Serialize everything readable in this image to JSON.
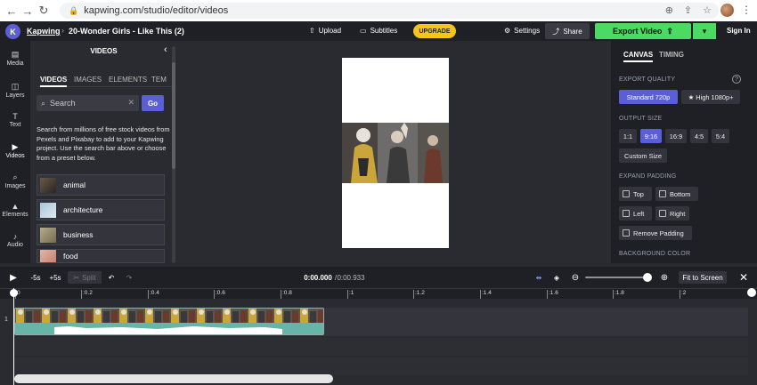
{
  "browser": {
    "url": "kapwing.com/studio/editor/videos"
  },
  "topbar": {
    "brand": "Kapwing",
    "project_title": "20-Wonder Girls - Like This (2)",
    "upload_label": "Upload",
    "subtitles_label": "Subtitles",
    "upgrade_label": "UPGRADE",
    "settings_label": "Settings",
    "share_label": "Share",
    "export_label": "Export Video",
    "signin_label": "Sign In"
  },
  "rail": {
    "items": [
      {
        "label": "Media",
        "icon": "media-icon"
      },
      {
        "label": "Layers",
        "icon": "layers-icon"
      },
      {
        "label": "Text",
        "icon": "text-icon"
      },
      {
        "label": "Videos",
        "icon": "videos-icon"
      },
      {
        "label": "Images",
        "icon": "images-icon"
      },
      {
        "label": "Elements",
        "icon": "elements-icon"
      },
      {
        "label": "Audio",
        "icon": "audio-icon"
      }
    ]
  },
  "panel": {
    "title": "VIDEOS",
    "tabs": [
      "VIDEOS",
      "IMAGES",
      "ELEMENTS",
      "TEM"
    ],
    "search_placeholder": "Search",
    "go_label": "Go",
    "description": "Search from millions of free stock videos from Pexels and Pixabay to add to your Kapwing project. Use the search bar above or choose from a preset below.",
    "presets": [
      "animal",
      "architecture",
      "business",
      "food"
    ]
  },
  "right_panel": {
    "tabs": [
      "CANVAS",
      "TIMING"
    ],
    "export_quality_label": "EXPORT QUALITY",
    "quality_standard": "Standard 720p",
    "quality_high": "★ High 1080p+",
    "output_size_label": "OUTPUT SIZE",
    "sizes": [
      "1:1",
      "9:16",
      "16:9",
      "4:5",
      "5:4"
    ],
    "custom_size": "Custom Size",
    "expand_padding_label": "EXPAND PADDING",
    "padding_top": "Top",
    "padding_bottom": "Bottom",
    "padding_left": "Left",
    "padding_right": "Right",
    "remove_padding": "Remove Padding",
    "background_color_label": "BACKGROUND COLOR"
  },
  "timeline": {
    "minus5": "-5s",
    "plus5": "+5s",
    "split": "Split",
    "time_current": "0:00.000",
    "time_total": "0:00.933",
    "fit_to_screen": "Fit to Screen",
    "ruler_ticks": [
      "0",
      ":0.2",
      ":0.4",
      ":0.6",
      ":0.8",
      ":1",
      ":1.2",
      ":1.4",
      ":1.6",
      ":1.8",
      ":2"
    ],
    "track_number": "1",
    "zoom_level": 0.95
  },
  "colors": {
    "accent": "#5b5fd6",
    "export_green": "#4cd964",
    "upgrade_yellow": "#f5c518"
  }
}
